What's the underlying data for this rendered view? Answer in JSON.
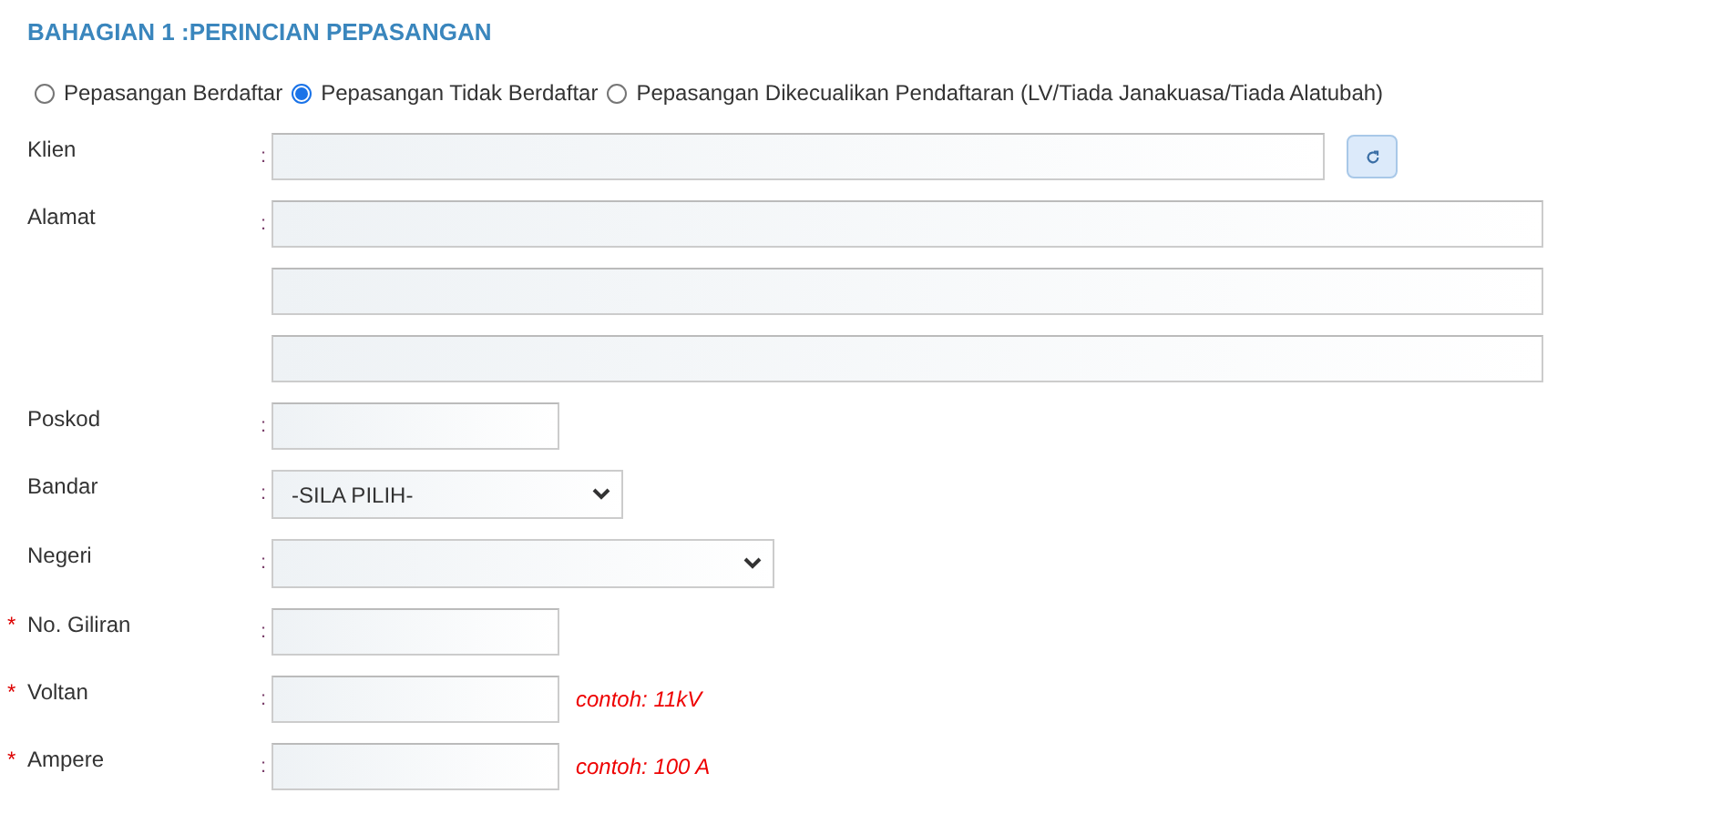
{
  "section_title": "BAHAGIAN 1 :PERINCIAN PEPASANGAN",
  "installation_type": [
    {
      "label": "Pepasangan Berdaftar",
      "selected": false
    },
    {
      "label": "Pepasangan Tidak Berdaftar",
      "selected": true
    },
    {
      "label": "Pepasangan Dikecualikan Pendaftaran (LV/Tiada Janakuasa/Tiada Alatubah)",
      "selected": false
    }
  ],
  "fields": [
    {
      "kind": "lookup",
      "label": "Klien",
      "separator": ":"
    },
    {
      "kind": "address",
      "label": "Alamat",
      "separator": ":"
    },
    {
      "kind": "text",
      "label": "Poskod",
      "separator": ":"
    },
    {
      "kind": "select",
      "label": "Bandar",
      "separator": ":",
      "value": "-SILA PILIH-"
    },
    {
      "kind": "select",
      "label": "Negeri",
      "separator": ":"
    },
    {
      "kind": "text",
      "label": "No. Giliran",
      "separator": ":",
      "required_mark": "*"
    },
    {
      "kind": "text",
      "label": "Voltan",
      "separator": ":",
      "required_mark": "*",
      "hint": "contoh: 11kV"
    },
    {
      "kind": "text",
      "label": "Ampere",
      "separator": ":",
      "required_mark": "*",
      "hint": "contoh: 100 A"
    }
  ]
}
